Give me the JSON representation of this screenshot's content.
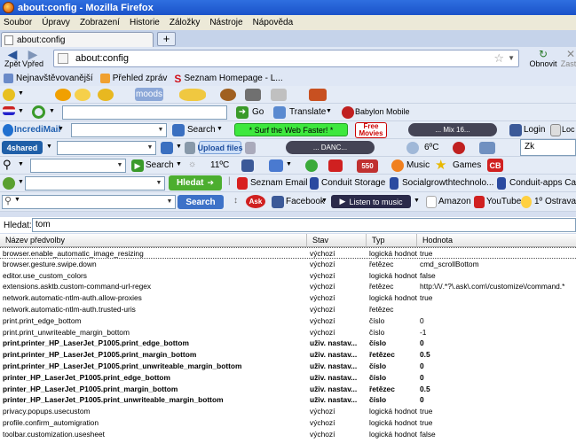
{
  "window": {
    "title": "about:config - Mozilla Firefox"
  },
  "menu": [
    "Soubor",
    "Úpravy",
    "Zobrazení",
    "Historie",
    "Záložky",
    "Nástroje",
    "Nápověda"
  ],
  "tab": {
    "label": "about:config",
    "new_tab": "+"
  },
  "nav": {
    "back": "Zpět",
    "forward": "Vpřed",
    "url": "about:config",
    "reload": "Obnovit",
    "stop": "Zasta"
  },
  "bookmarks": [
    "Nejnavštěvovanější",
    "Přehled zpráv",
    "Seznam Homepage - L..."
  ],
  "toolbar1": {
    "moods": "moods"
  },
  "toolbar2": {
    "go": "Go",
    "translate": "Translate",
    "babylon": "Babylon Mobile"
  },
  "toolbar3": {
    "incredimail": "IncrediMail",
    "search": "Search",
    "surf": "* Surf the Web Faster! *",
    "free_movies_top": "Free",
    "free_movies_bottom": "Movies",
    "mix": "... Mix 16...",
    "login": "Login",
    "local": "Loc"
  },
  "toolbar4": {
    "shared": "4shared",
    "upload": "Upload files",
    "dance": "... DANC...",
    "temp": "6ºC",
    "zk": "Zk"
  },
  "toolbar5": {
    "search": "Search",
    "temp": "11ºC",
    "badge": "550",
    "music": "Music",
    "games": "Games",
    "cb": "CB"
  },
  "toolbar6": {
    "hledat": "Hledat",
    "seznam_email": "Seznam Email",
    "conduit_storage": "Conduit Storage",
    "social": "Socialgrowthtechnolo...",
    "conduit_apps": "Conduit-apps Cap"
  },
  "toolbar7": {
    "search_btn": "Search",
    "ask": "Ask",
    "facebook": "Facebook",
    "listen": "Listen to music",
    "amazon": "Amazon",
    "youtube": "YouTube",
    "weather": "1º Ostrava,"
  },
  "filter": {
    "label": "Hledat:",
    "value": "tom"
  },
  "table": {
    "headers": [
      "Název předvolby",
      "Stav",
      "Typ",
      "Hodnota"
    ],
    "rows": [
      {
        "name": "browser.enable_automatic_image_resizing",
        "status": "výchozí",
        "type": "logická hodnota",
        "value": "true",
        "bold": false,
        "selected": true
      },
      {
        "name": "browser.gesture.swipe.down",
        "status": "výchozí",
        "type": "řetězec",
        "value": "cmd_scrollBottom",
        "bold": false
      },
      {
        "name": "editor.use_custom_colors",
        "status": "výchozí",
        "type": "logická hodnota",
        "value": "false",
        "bold": false
      },
      {
        "name": "extensions.asktb.custom-command-url-regex",
        "status": "výchozí",
        "type": "řetězec",
        "value": "http:\\/\\/.*?\\.ask\\.com\\/customize\\/command.*",
        "bold": false
      },
      {
        "name": "network.automatic-ntlm-auth.allow-proxies",
        "status": "výchozí",
        "type": "logická hodnota",
        "value": "true",
        "bold": false
      },
      {
        "name": "network.automatic-ntlm-auth.trusted-uris",
        "status": "výchozí",
        "type": "řetězec",
        "value": "",
        "bold": false
      },
      {
        "name": "print.print_edge_bottom",
        "status": "výchozí",
        "type": "číslo",
        "value": "0",
        "bold": false
      },
      {
        "name": "print.print_unwriteable_margin_bottom",
        "status": "výchozí",
        "type": "číslo",
        "value": "-1",
        "bold": false
      },
      {
        "name": "print.printer_HP_LaserJet_P1005.print_edge_bottom",
        "status": "uživ. nastav...",
        "type": "číslo",
        "value": "0",
        "bold": true
      },
      {
        "name": "print.printer_HP_LaserJet_P1005.print_margin_bottom",
        "status": "uživ. nastav...",
        "type": "řetězec",
        "value": "0.5",
        "bold": true
      },
      {
        "name": "print.printer_HP_LaserJet_P1005.print_unwriteable_margin_bottom",
        "status": "uživ. nastav...",
        "type": "číslo",
        "value": "0",
        "bold": true
      },
      {
        "name": "printer_HP_LaserJet_P1005.print_edge_bottom",
        "status": "uživ. nastav...",
        "type": "číslo",
        "value": "0",
        "bold": true
      },
      {
        "name": "printer_HP_LaserJet_P1005.print_margin_bottom",
        "status": "uživ. nastav...",
        "type": "řetězec",
        "value": "0.5",
        "bold": true
      },
      {
        "name": "printer_HP_LaserJet_P1005.print_unwriteable_margin_bottom",
        "status": "uživ. nastav...",
        "type": "číslo",
        "value": "0",
        "bold": true
      },
      {
        "name": "privacy.popups.usecustom",
        "status": "výchozí",
        "type": "logická hodnota",
        "value": "true",
        "bold": false
      },
      {
        "name": "profile.confirm_automigration",
        "status": "výchozí",
        "type": "logická hodnota",
        "value": "true",
        "bold": false
      },
      {
        "name": "toolbar.customization.usesheet",
        "status": "výchozí",
        "type": "logická hodnota",
        "value": "false",
        "bold": false
      }
    ]
  },
  "colors": {
    "titlebar": "#1a52c9",
    "hledat_green": "#4cae2f",
    "search_blue": "#3d72c8",
    "surf_green": "#3ee83e",
    "conduit_red": "#c00000"
  }
}
